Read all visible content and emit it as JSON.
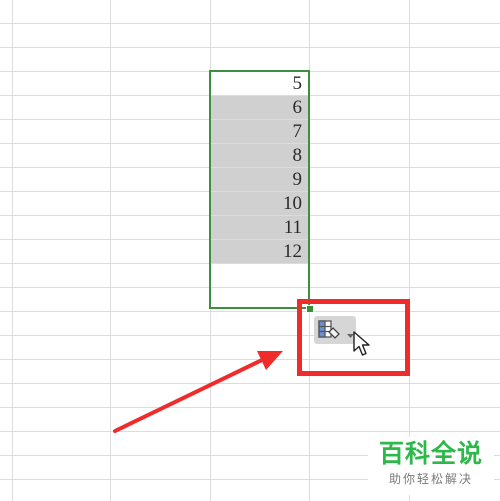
{
  "spreadsheet": {
    "cells": [
      {
        "value": "5"
      },
      {
        "value": "6"
      },
      {
        "value": "7"
      },
      {
        "value": "8"
      },
      {
        "value": "9"
      },
      {
        "value": "10"
      },
      {
        "value": "11"
      },
      {
        "value": "12"
      }
    ],
    "selection_color": "#3c8f3c"
  },
  "autofill_options": {
    "icon": "autofill-options-icon",
    "caret_icon": "chevron-down-icon"
  },
  "annotation": {
    "highlight_color": "#ef2b2b",
    "arrow_color": "#ef2b2b"
  },
  "watermark": {
    "title": "百科全说",
    "subtitle": "助你轻松解决"
  }
}
